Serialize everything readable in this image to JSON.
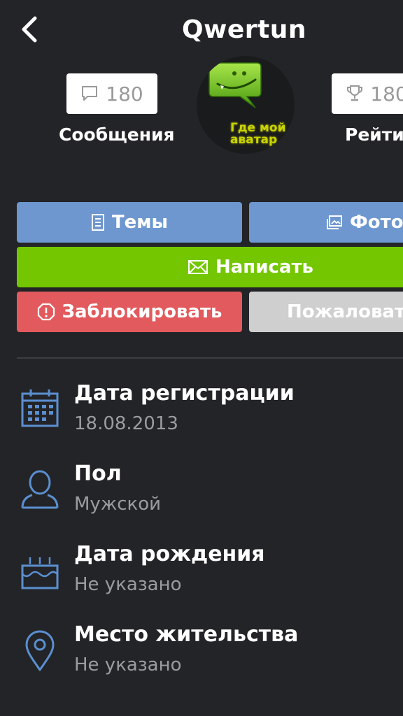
{
  "header": {
    "title": "Qwertun",
    "back_icon": "back-chevron-icon"
  },
  "stats": {
    "messages": {
      "count": "180",
      "label": "Сообщения",
      "icon": "speech-bubble-icon"
    },
    "rating": {
      "count": "180",
      "label": "Рейтинг",
      "icon": "trophy-icon"
    }
  },
  "avatar": {
    "text_line1": "Где мой",
    "text_line2": "аватар"
  },
  "buttons": {
    "topics": "Темы",
    "photo": "Фото",
    "write": "Написать",
    "block": "Заблокировать",
    "report": "Пожаловаться"
  },
  "info": [
    {
      "title": "Дата регистрации",
      "value": "18.08.2013",
      "icon": "calendar-icon"
    },
    {
      "title": "Пол",
      "value": "Мужской",
      "icon": "user-icon"
    },
    {
      "title": "Дата рождения",
      "value": "Не указано",
      "icon": "birthday-cake-icon"
    },
    {
      "title": "Место жительства",
      "value": "Не указано",
      "icon": "location-pin-icon"
    }
  ],
  "colors": {
    "background": "#232427",
    "blue": "#6e97d0",
    "green": "#74c700",
    "red": "#e25a5d",
    "gray": "#cfcfcf",
    "icon_blue": "#5b8fd0"
  }
}
